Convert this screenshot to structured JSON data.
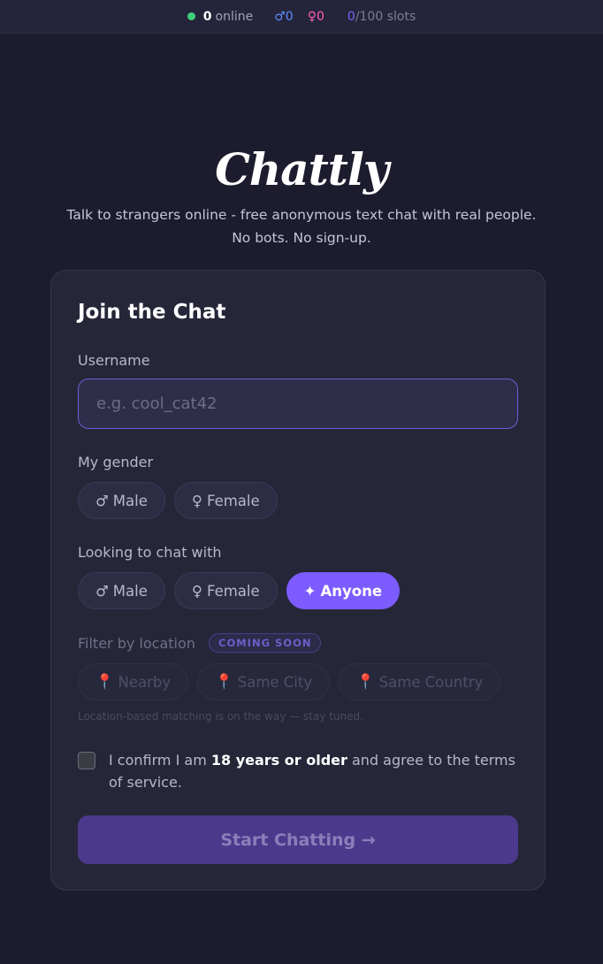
{
  "topbar": {
    "online_count": "0",
    "online_label": "online",
    "male_icon": "♂",
    "male_count": "0",
    "female_icon": "♀",
    "female_count": "0",
    "slots_used": "0",
    "slots_total": "/100 slots"
  },
  "brand": {
    "logo": "Chattly",
    "tagline_line1": "Talk to strangers online - free anonymous text chat with real people.",
    "tagline_line2": "No bots. No sign-up."
  },
  "form": {
    "title": "Join the Chat",
    "username_label": "Username",
    "username_placeholder": "e.g. cool_cat42",
    "username_value": "",
    "gender_label": "My gender",
    "gender_options": [
      {
        "icon": "♂",
        "label": "Male",
        "selected": false
      },
      {
        "icon": "♀",
        "label": "Female",
        "selected": false
      }
    ],
    "looking_label": "Looking to chat with",
    "looking_options": [
      {
        "icon": "♂",
        "label": "Male",
        "selected": false
      },
      {
        "icon": "♀",
        "label": "Female",
        "selected": false
      },
      {
        "icon": "✦",
        "label": "Anyone",
        "selected": true
      }
    ],
    "location_label": "Filter by location",
    "location_badge": "COMING SOON",
    "location_options": [
      {
        "icon": "📍",
        "label": "Nearby"
      },
      {
        "icon": "📍",
        "label": "Same City"
      },
      {
        "icon": "📍",
        "label": "Same Country"
      }
    ],
    "location_hint": "Location-based matching is on the way — stay tuned.",
    "consent_prefix": "I confirm I am ",
    "consent_bold": "18 years or older",
    "consent_suffix": " and agree to the terms of service.",
    "consent_checked": false,
    "submit_label": "Start Chatting →"
  },
  "colors": {
    "accent": "#7c5cff",
    "online": "#3fcf7a",
    "male": "#5b8cff",
    "female": "#ff5fb8",
    "background": "#1c1c2e",
    "card": "#262639"
  }
}
